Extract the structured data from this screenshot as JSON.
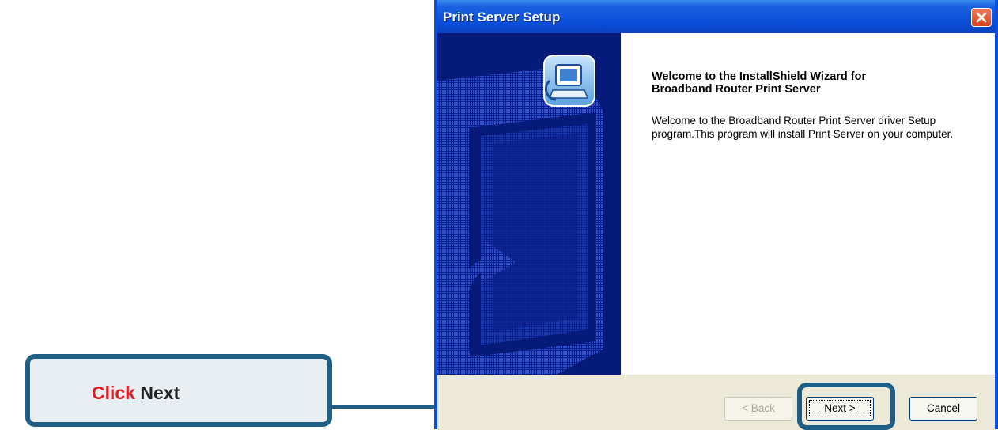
{
  "window": {
    "title": "Print Server Setup"
  },
  "wizard": {
    "heading": "Welcome to the InstallShield Wizard for\nBroadband Router Print Server",
    "body": "Welcome to the Broadband Router Print Server driver Setup program.This program will install Print Server on your computer."
  },
  "buttons": {
    "back": {
      "accel": "B",
      "rest": "ack",
      "prefix": "< "
    },
    "next": {
      "accel": "N",
      "rest": "ext >"
    },
    "cancel": "Cancel"
  },
  "callout": {
    "verb": "Click",
    "target": "Next"
  },
  "colors": {
    "titlebar": "#0a4ed8",
    "sidebar": "#061a7a",
    "callout_border": "#1f5f86",
    "accent_red": "#e21b23"
  },
  "icons": [
    "close-icon",
    "setup-computer-icon",
    "installshield-banner"
  ]
}
